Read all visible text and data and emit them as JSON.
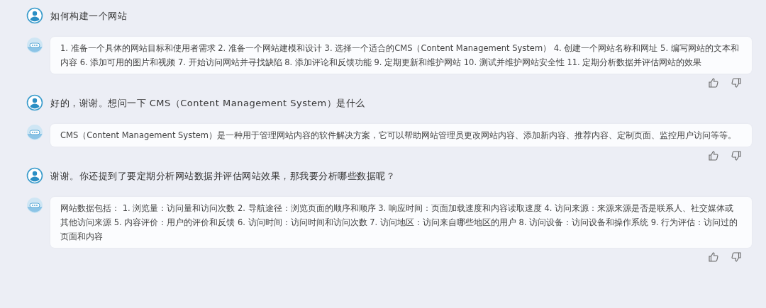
{
  "messages": [
    {
      "kind": "user",
      "text": "如何构建一个网站"
    },
    {
      "kind": "bot",
      "text": "1. 准备一个具体的网站目标和使用者需求 2. 准备一个网站建模和设计 3. 选择一个适合的CMS（Content Management System） 4. 创建一个网站名称和网址 5. 编写网站的文本和内容 6. 添加可用的图片和视频 7. 开始访问网站并寻找缺陷 8. 添加评论和反馈功能 9. 定期更新和维护网站 10. 测试并维护网站安全性 11. 定期分析数据并评估网站的效果"
    },
    {
      "kind": "user",
      "text": "好的，谢谢。想问一下 CMS（Content Management System）是什么"
    },
    {
      "kind": "bot",
      "text": "CMS（Content Management System）是一种用于管理网站内容的软件解决方案，它可以帮助网站管理员更改网站内容、添加新内容、推荐内容、定制页面、监控用户访问等等。"
    },
    {
      "kind": "user",
      "text": "谢谢。你还提到了要定期分析网站数据并评估网站效果，那我要分析哪些数据呢？"
    },
    {
      "kind": "bot",
      "text": "网站数据包括： 1. 浏览量：访问量和访问次数 2. 导航途径：浏览页面的顺序和顺序 3. 响应时间：页面加载速度和内容读取速度 4. 访问来源：来源来源是否是联系人、社交媒体或其他访问来源 5. 内容评价：用户的评价和反馈 6. 访问时间：访问时间和访问次数 7. 访问地区：访问来自哪些地区的用户 8. 访问设备：访问设备和操作系统 9. 行为评估：访问过的页面和内容"
    }
  ]
}
